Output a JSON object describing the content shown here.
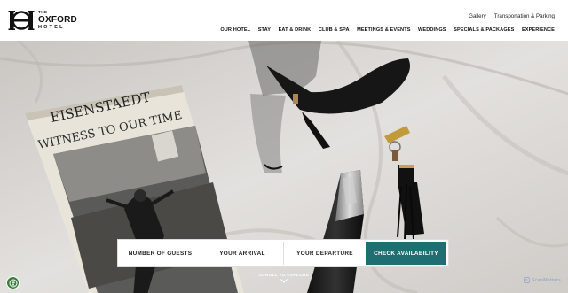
{
  "brand": {
    "the": "THE",
    "name": "OXFORD",
    "subtitle": "HOTEL"
  },
  "utility_nav": [
    {
      "label": "Gallery"
    },
    {
      "label": "Transportation & Parking"
    }
  ],
  "main_nav": [
    {
      "label": "OUR HOTEL"
    },
    {
      "label": "STAY"
    },
    {
      "label": "EAT & DRINK"
    },
    {
      "label": "CLUB & SPA"
    },
    {
      "label": "MEETINGS & EVENTS"
    },
    {
      "label": "WEDDINGS"
    },
    {
      "label": "SPECIALS & PACKAGES"
    },
    {
      "label": "EXPERIENCE"
    }
  ],
  "hero": {
    "book_title": "EISENSTAEDT",
    "book_subtitle": "WITNESS TO OUR TIME"
  },
  "booking": {
    "guests_label": "NUMBER OF GUESTS",
    "arrival_label": "YOUR ARRIVAL",
    "departure_label": "YOUR DEPARTURE",
    "check_label": "CHECK AVAILABILITY",
    "accent_color": "#1e6e72"
  },
  "scroll_label": "SCROLL TO EXPLORE",
  "badge_label": "ScanMatters"
}
